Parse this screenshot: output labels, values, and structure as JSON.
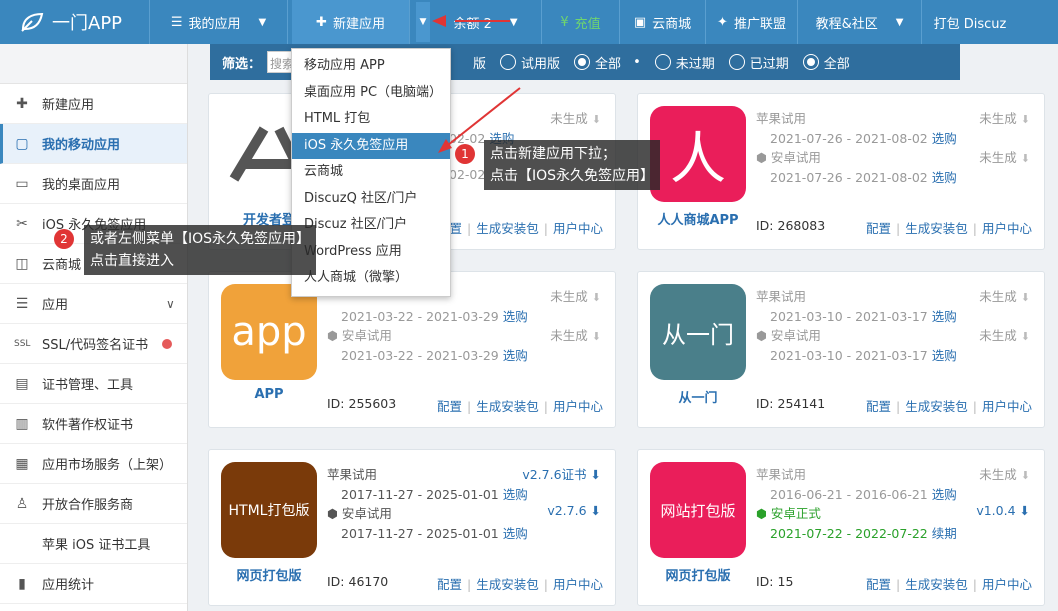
{
  "topbar": {
    "logo": "一门APP",
    "nav": [
      {
        "label": "我的应用"
      },
      {
        "label": "新建应用"
      },
      {
        "label": "余额 2"
      },
      {
        "label": "充值"
      },
      {
        "label": "云商城"
      },
      {
        "label": "推广联盟"
      },
      {
        "label": "教程&社区"
      },
      {
        "label": "打包 Discuz"
      }
    ]
  },
  "filter": {
    "label": "筛选：",
    "search_placeholder": "搜索",
    "opt_version": "版",
    "opt_trial": "试用版",
    "opt_all1": "全部",
    "opt_unexpired": "未过期",
    "opt_expired": "已过期",
    "opt_all2": "全部"
  },
  "sidebar": [
    {
      "label": "新建应用",
      "icon": "plus-icon"
    },
    {
      "label": "我的移动应用",
      "icon": "mobile-icon"
    },
    {
      "label": "我的桌面应用",
      "icon": "desktop-icon"
    },
    {
      "label": "iOS 永久免签应用",
      "icon": "scissors-icon"
    },
    {
      "label": "云商城",
      "icon": "bag-icon"
    },
    {
      "label": "应用",
      "icon": "menu-icon"
    },
    {
      "label": "SSL/代码签名证书",
      "icon": "ssl-icon"
    },
    {
      "label": "证书管理、工具",
      "icon": "cert-icon"
    },
    {
      "label": "软件著作权证书",
      "icon": "copyright-icon"
    },
    {
      "label": "应用市场服务（上架）",
      "icon": "store-icon"
    },
    {
      "label": "开放合作服务商",
      "icon": "partner-icon"
    },
    {
      "label": "苹果 iOS 证书工具",
      "icon": "apple-icon"
    },
    {
      "label": "应用统计",
      "icon": "chart-icon"
    }
  ],
  "dropdown": [
    "移动应用 APP",
    "桌面应用 PC（电脑端）",
    "HTML 打包",
    "iOS 永久免签应用",
    "云商城",
    "DiscuzQ 社区/门户",
    "Discuz 社区/门户",
    "WordPress 应用",
    "人人商城（微擎）"
  ],
  "callouts": {
    "one_num": "1",
    "one_l1": "点击新建应用下拉；",
    "one_l2": "点击【IOS永久免签应用】",
    "two_num": "2",
    "two_l1": "或者左侧菜单【IOS永久免签应用】",
    "two_l2": "点击直接进入"
  },
  "common": {
    "not_generated": "未生成",
    "apple_trial": "苹果试用",
    "android_trial": "安卓试用",
    "android_official": "安卓正式",
    "pick": "选购",
    "renew": "续期",
    "config": "配置",
    "gen_pkg": "生成安装包",
    "user_center": "用户中心"
  },
  "cards": [
    {
      "name": "开发者登",
      "thumb_text": "",
      "id": "",
      "apple_date": "02-02",
      "android_date": "02-02"
    },
    {
      "name": "人人商城APP",
      "thumb_text": "人",
      "id": "ID: 268083",
      "apple_date": "2021-07-26 - 2021-08-02",
      "android_date": "2021-07-26 - 2021-08-02"
    },
    {
      "name": "APP",
      "thumb_text": "app",
      "id": "ID: 255603",
      "apple_date": "2021-03-22 - 2021-03-29",
      "android_date": "2021-03-22 - 2021-03-29"
    },
    {
      "name": "从一门",
      "thumb_text": "从一门",
      "id": "ID: 254141",
      "apple_date": "2021-03-10 - 2021-03-17",
      "android_date": "2021-03-10 - 2021-03-17"
    },
    {
      "name": "网页打包版",
      "thumb_text": "HTML打包版",
      "id": "ID: 46170",
      "apple_date": "2017-11-27 - 2025-01-01",
      "android_date": "2017-11-27 - 2025-01-01",
      "apple_ver": "v2.7.6证书",
      "android_ver": "v2.7.6"
    },
    {
      "name": "网页打包版",
      "thumb_text": "网站打包版",
      "id": "ID: 15",
      "apple_date": "2016-06-21 - 2016-06-21",
      "android_date": "2021-07-22 - 2022-07-22",
      "android_ver": "v1.0.4"
    }
  ],
  "colors": {
    "topbar": "#3a87be",
    "filter": "#2f6e9e",
    "accent": "#2a6fb0",
    "callout_badge": "#e03535"
  }
}
